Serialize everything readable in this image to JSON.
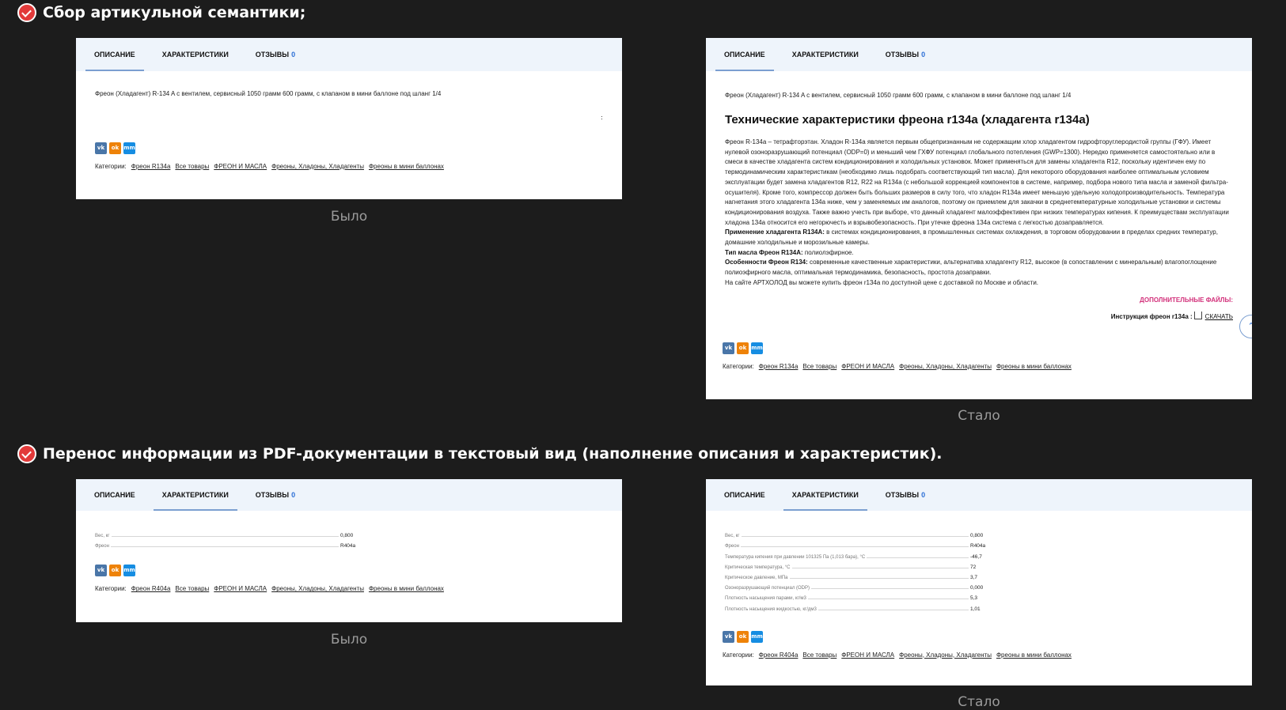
{
  "sections": [
    {
      "title": "Сбор артикульной семантики;"
    },
    {
      "title": "Перенос информации из PDF-документации в текстовый вид (наполнение описания и характеристик)."
    }
  ],
  "tabs": {
    "description": "ОПИСАНИЕ",
    "characteristics": "ХАРАКТЕРИСТИКИ",
    "reviews": "ОТЗЫВЫ",
    "reviews_count": "0"
  },
  "captions": {
    "before": "Было",
    "after": "Стало"
  },
  "social": {
    "vk": "vk",
    "ok": "ok",
    "mm": "mm"
  },
  "categories_label": "Категории:",
  "product_intro": "Фреон (Хладагент) R-134 A с вентилем, сервисный 1050 грамм 600 грамм, с клапаном в мини баллоне под шланг 1/4",
  "colon": ":",
  "categories_r134a": [
    "Фреон R134a",
    "Все товары",
    "ФРЕОН И МАСЛА",
    "Фреоны, Хладоны, Хладагенты",
    "Фреоны в мини баллонах"
  ],
  "categories_r404a": [
    "Фреон R404a",
    "Все товары",
    "ФРЕОН И МАСЛА",
    "Фреоны, Хладоны, Хладагенты",
    "Фреоны в мини баллонах"
  ],
  "after_desc": {
    "heading": "Технические характеристики фреона r134a (хладагента r134a)",
    "paragraph": "Фреон R-134a – тетрафторэтан. Хладон R-134a является первым общепризнанным не содержащим хлор хладагентом гидрофторуглеродистой группы (ГФУ). Имеет нулевой озоноразрушающий потенциал (ODP=0) и меньший чем ГХФУ потенциал глобального потепления (GWP=1300). Нередко применяется самостоятельно или в смеси в качестве хладагента систем кондиционирования и холодильных установок. Может применяться для замены хладагента R12, поскольку идентичен ему по термодинамическим характеристикам (необходимо лишь подобрать соответствующий тип масла). Для некоторого оборудования наиболее оптимальным условием эксплуатации будет замена хладагентов R12, R22 на R134a (с небольшой коррекцией компонентов в системе, например, подбора нового типа масла и заменой фильтра-осушителя). Кроме того, компрессор должен быть больших размеров в силу того, что хладон R134a имеет меньшую удельную холодопроизводительность. Температура нагнетания этого хладагента 134a ниже, чем у заменяемых им аналогов, поэтому он приемлем для закачки в среднетемпературные холодильные установки и системы кондиционирования воздуха. Также важно учесть при выборе, что данный хладагент малоэффективен при низких температурах кипения. К преимуществам эксплуатации хладона 134a относится его негорючесть и взрывобезопасность. При утечке фреона 134a система с легкостью дозаправляется.",
    "application_label": "Применение хладагента R134A:",
    "application_text": " в системах кондиционирования, в промышленных системах охлаждения, в торговом оборудовании в пределах средних температур, домашние холодильные и морозильные камеры.",
    "oil_label": "Тип масла Фреон R134A:",
    "oil_text": " полиолэфирное.",
    "features_label": "Особенности Фреон R134:",
    "features_text": " современные качественные характеристики, альтернатива хладагенту R12, высокое (в сопоставлении с минеральным) влагопоглощение полиоэфирного масла, оптимальная термодинамика, безопасность, простота дозаправки.",
    "buy_text": "На сайте АРТХОЛОД вы можете купить фреон r134a по доступной цене с доставкой по Москве и области.",
    "files_title": "ДОПОЛНИТЕЛЬНЫЕ ФАЙЛЫ:",
    "files_item": "Инструкция фреон r134a :",
    "files_download": "СКАЧАТЬ"
  },
  "specs_before": [
    {
      "name": "Вес, кг",
      "value": "0,800"
    },
    {
      "name": "Фреон",
      "value": "R404a"
    }
  ],
  "specs_after": [
    {
      "name": "Вес, кг",
      "value": "0,800"
    },
    {
      "name": "Фреон",
      "value": "R404a"
    },
    {
      "name": "Температура кипения при давлении 101325 Па (1,013 бара), °C",
      "value": "-46,7"
    },
    {
      "name": "Критическая температура, °C",
      "value": "72"
    },
    {
      "name": "Критическое давление, МПа",
      "value": "3,7"
    },
    {
      "name": "Озоноразрушающий потенциал (ODP)",
      "value": "0,000"
    },
    {
      "name": "Плотность насыщения парами, кг/м3",
      "value": "5,3"
    },
    {
      "name": "Плотность насыщения жидкостью, кг/дм3",
      "value": "1,01"
    }
  ]
}
